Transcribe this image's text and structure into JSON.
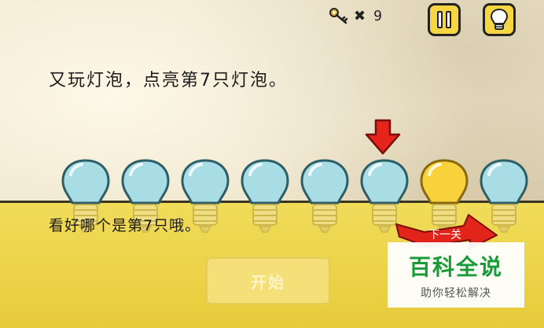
{
  "hud": {
    "keys_times": "✖",
    "keys_count": "9",
    "pause_icon": "pause-icon",
    "hint_icon": "lightbulb-icon"
  },
  "prompt": "又玩灯泡，点亮第7只灯泡。",
  "bulbs": [
    {
      "lit": false
    },
    {
      "lit": false
    },
    {
      "lit": false
    },
    {
      "lit": false
    },
    {
      "lit": false
    },
    {
      "lit": false
    },
    {
      "lit": true
    },
    {
      "lit": false
    }
  ],
  "sub_prompt": "看好哪个是第7只哦。",
  "start_button": "开始",
  "next_ribbon": "下一关",
  "watermark": {
    "title": "百科全说",
    "subtitle": "助你轻松解决"
  },
  "colors": {
    "bulb_off": "#a8dde6",
    "bulb_on": "#f8d23a",
    "panel": "#ecd24a",
    "arrow": "#e5241b",
    "watermark_green": "#1a9b3a"
  }
}
